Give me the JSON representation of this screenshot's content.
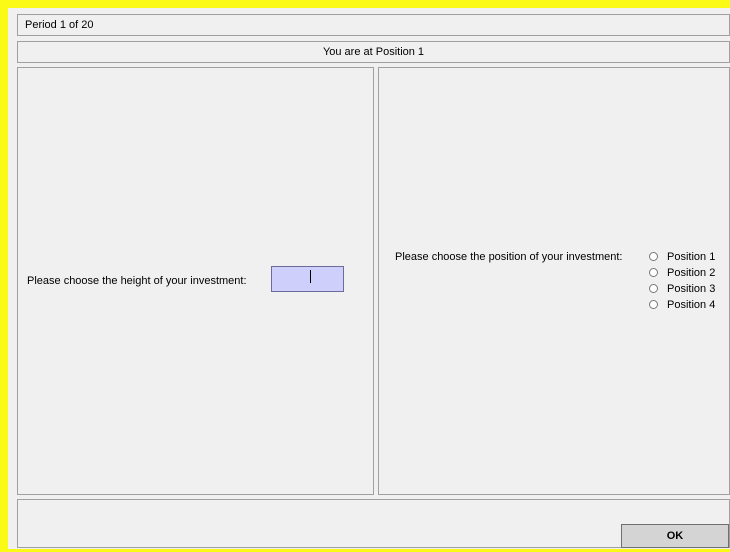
{
  "header": {
    "period_text": "Period 1 of 20"
  },
  "subheader": {
    "position_text": "You are at Position 1"
  },
  "left_panel": {
    "height_label": "Please choose the height of your investment:",
    "height_value": ""
  },
  "right_panel": {
    "position_label": "Please choose the position of your investment:",
    "options": [
      {
        "label": "Position 1",
        "selected": false
      },
      {
        "label": "Position 2",
        "selected": false
      },
      {
        "label": "Position 3",
        "selected": false
      },
      {
        "label": "Position 4",
        "selected": false
      }
    ]
  },
  "footer": {
    "ok_label": "OK"
  },
  "colors": {
    "frame": "#fafa16",
    "panel": "#f0f0f0",
    "input_background": "#cfcffb",
    "button": "#d4d4d4"
  }
}
